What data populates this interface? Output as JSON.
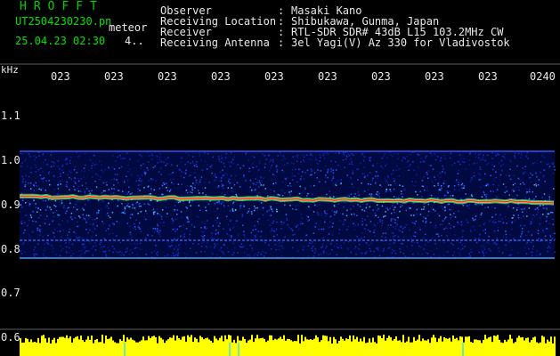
{
  "app": {
    "title": "HROFFT"
  },
  "file": {
    "name": "UT2504230230.pn",
    "meteor_label": "meteor",
    "datetime": "25.04.23 02:30",
    "count": "4.."
  },
  "info": [
    {
      "label": "Observer",
      "value": "Masaki Kano"
    },
    {
      "label": "Receiving Location",
      "value": "Shibukawa, Gunma, Japan"
    },
    {
      "label": "Receiver",
      "value": "RTL-SDR SDR# 43dB L15 103.2MHz CW"
    },
    {
      "label": "Receiving Antenna",
      "value": "3el Yagi(V) Az 330 for Vladivostok"
    }
  ],
  "axis": {
    "unit": "kHz",
    "x_ticks": [
      "023",
      "023",
      "023",
      "023",
      "023",
      "023",
      "023",
      "023",
      "023",
      "0240"
    ],
    "y_ticks": [
      "1.1",
      "1.0",
      "0.9",
      "0.8",
      "0.7",
      "0.6"
    ]
  },
  "colors": {
    "background": "#000000",
    "text": "#e8e8e8",
    "title_green": "#00d000",
    "noise_blue": "#1a3aff",
    "signal_red": "#ff3030",
    "meteor_bar_yellow": "#ffff00",
    "gridline": "#606060"
  },
  "spectrogram": {
    "carrier_khz": 0.91,
    "band_top_khz": 1.02,
    "band_bottom_khz": 0.78,
    "secondary_line_khz": 0.82,
    "lower_line_khz": 0.78
  }
}
